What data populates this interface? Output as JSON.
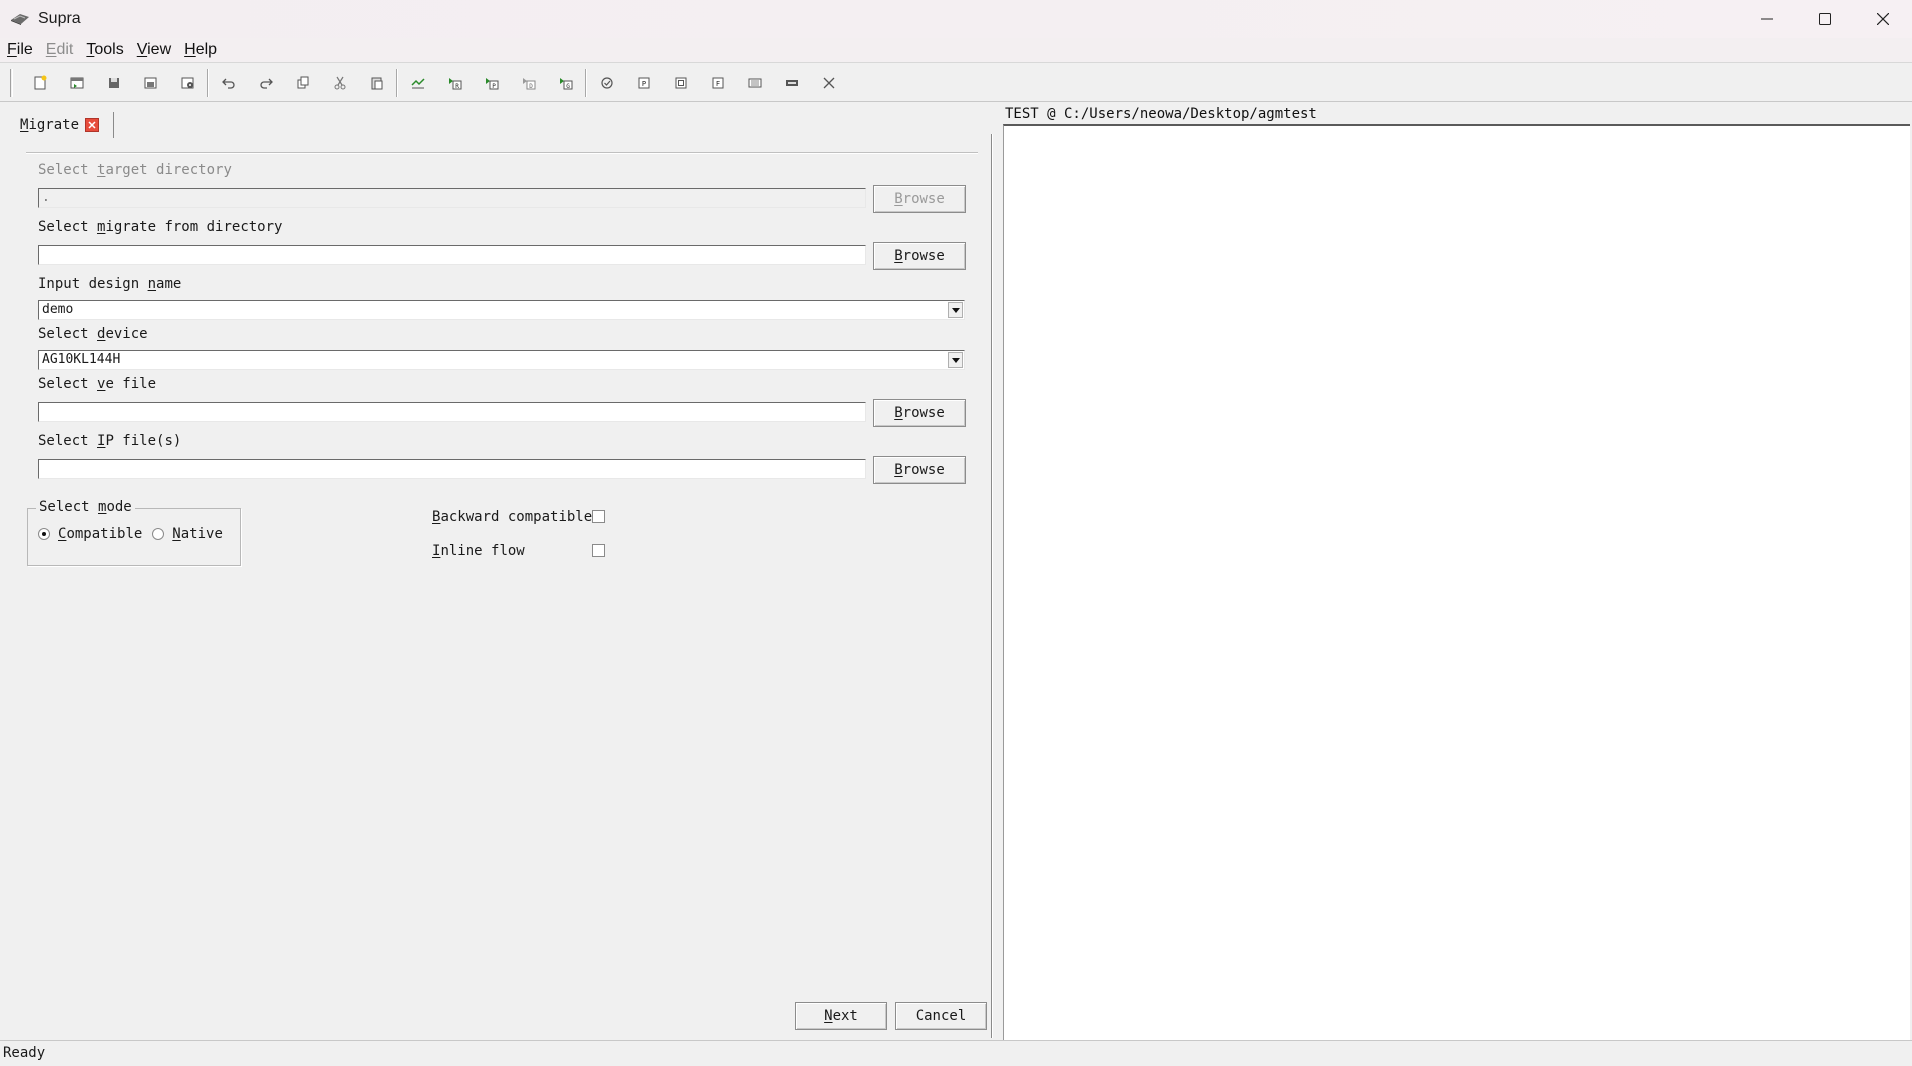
{
  "window": {
    "title": "Supra",
    "controls": [
      "minimize-icon",
      "maximize-icon",
      "close-icon"
    ]
  },
  "menu": {
    "file": "File",
    "edit": "Edit",
    "tools": "Tools",
    "view": "View",
    "help": "Help"
  },
  "toolbar": {
    "groups": [
      [
        "new-file-icon",
        "open-project-icon",
        "save-icon",
        "save-as-icon",
        "settings-icon"
      ],
      [
        "undo-icon",
        "redo-icon",
        "copy-icon",
        "cut-icon",
        "paste-icon"
      ],
      [
        "compile-icon",
        "run-r-icon",
        "run-p-icon",
        "run-d-icon",
        "run-g-icon"
      ],
      [
        "check-icon",
        "program-icon",
        "device-icon",
        "flash-icon",
        "chip-icon",
        "jtag-icon",
        "stop-icon"
      ]
    ]
  },
  "tab": {
    "label": "Migrate",
    "label_rest": "igrate",
    "label_ul": "M"
  },
  "form": {
    "target_dir": {
      "pre": "Select ",
      "ul": "t",
      "post": "arget directory",
      "value": "."
    },
    "migrate_from": {
      "pre": "Select ",
      "ul": "m",
      "post": "igrate from directory",
      "value": ""
    },
    "design_name": {
      "pre": "Input design ",
      "ul": "n",
      "post": "ame",
      "value": "demo"
    },
    "device": {
      "pre": "Select ",
      "ul": "d",
      "post": "evice",
      "value": "AG10KL144H"
    },
    "ve_file": {
      "pre": "Select ",
      "ul": "v",
      "post": "e file",
      "value": ""
    },
    "ip_files": {
      "pre": "Select ",
      "ul": "I",
      "post": "P file(s)",
      "value": ""
    },
    "browse_label_ul": "B",
    "browse_label_rest": "rowse"
  },
  "mode": {
    "title_pre": "Select ",
    "title_ul": "m",
    "title_post": "ode",
    "compatible_ul": "C",
    "compatible_rest": "ompatible",
    "native_ul": "N",
    "native_rest": "ative",
    "selected": "Compatible"
  },
  "options": {
    "backward_ul": "B",
    "backward_rest": "ackward compatible",
    "backward_checked": false,
    "inline_ul": "I",
    "inline_rest": "nline flow",
    "inline_checked": false
  },
  "buttons": {
    "next_ul": "N",
    "next_rest": "ext",
    "cancel": "Cancel"
  },
  "right_panel": {
    "header": "TEST @ C:/Users/neowa/Desktop/agmtest"
  },
  "status": {
    "text": "Ready"
  }
}
